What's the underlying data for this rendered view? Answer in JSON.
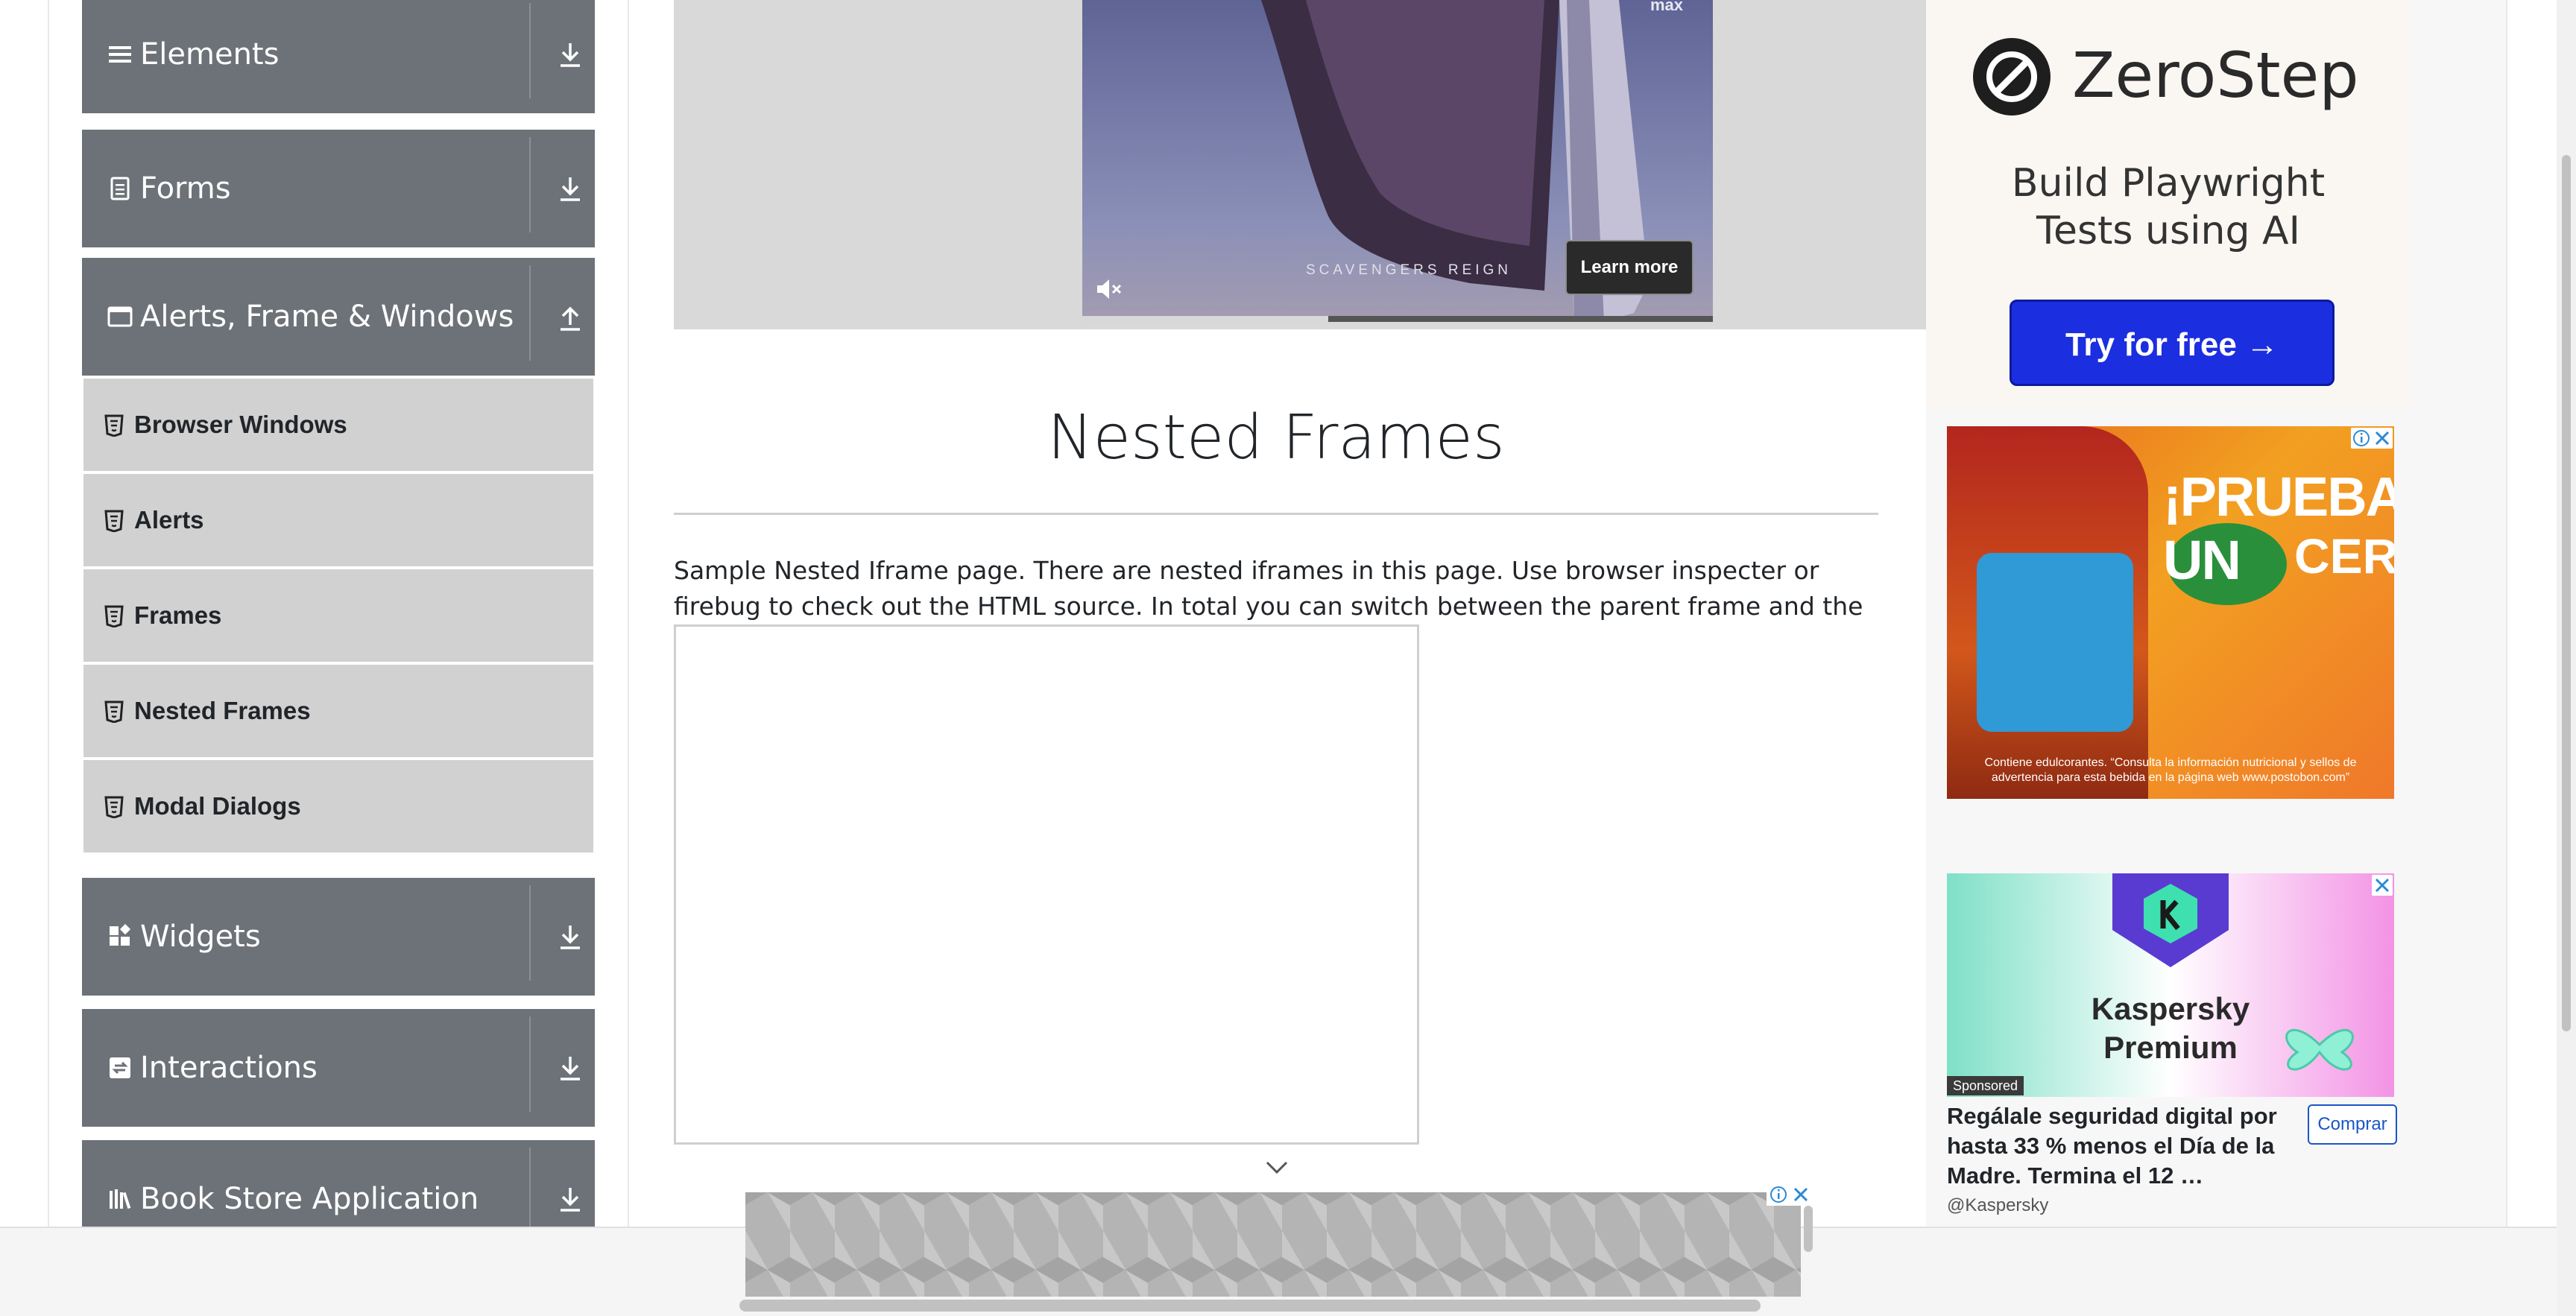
{
  "sidebar": {
    "groups": [
      {
        "label": "Elements",
        "icon": "hamburger-icon",
        "state": "collapsed"
      },
      {
        "label": "Forms",
        "icon": "document-icon",
        "state": "collapsed"
      },
      {
        "label": "Alerts, Frame & Windows",
        "icon": "window-icon",
        "state": "expanded"
      },
      {
        "label": "Widgets",
        "icon": "widgets-icon",
        "state": "collapsed"
      },
      {
        "label": "Interactions",
        "icon": "interactions-icon",
        "state": "collapsed"
      },
      {
        "label": "Book Store Application",
        "icon": "books-icon",
        "state": "collapsed"
      }
    ],
    "subitems": [
      {
        "label": "Browser Windows"
      },
      {
        "label": "Alerts"
      },
      {
        "label": "Frames"
      },
      {
        "label": "Nested Frames"
      },
      {
        "label": "Modal Dialogs"
      }
    ]
  },
  "video_ad": {
    "max_mark": "max",
    "caption": "SCAVENGERS REIGN",
    "learn_more": "Learn more",
    "progress": 0.39
  },
  "main": {
    "title": "Nested Frames",
    "intro": "Sample Nested Iframe page. There are nested iframes in this page. Use browser inspecter or firebug to check out the HTML source. In total you can switch between the parent frame and the nested child frame."
  },
  "ads": {
    "zerostep": {
      "name": "ZeroStep",
      "tagline_line1": "Build Playwright",
      "tagline_line2": "Tests using AI",
      "cta": "Try for free →"
    },
    "tea": {
      "headline_line1": "¡PRUEBA UN",
      "headline_line2": "CERO",
      "fine_print": "Contiene edulcorantes. “Consulta la información nutricional y sellos de advertencia para esta bebida en la página web www.postobon.com”"
    },
    "kaspersky": {
      "title_line1": "Kaspersky",
      "title_line2": "Premium",
      "sponsored": "Sponsored",
      "text": "Regálale seguridad digital por hasta 33 % menos el Día de la Madre. Termina el 12 …",
      "cta": "Comprar",
      "handle": "@Kaspersky"
    }
  },
  "colors": {
    "group_bg": "#6d7278",
    "sub_bg": "#d1d1d1",
    "zerostep_cta": "#1b2ee0"
  }
}
